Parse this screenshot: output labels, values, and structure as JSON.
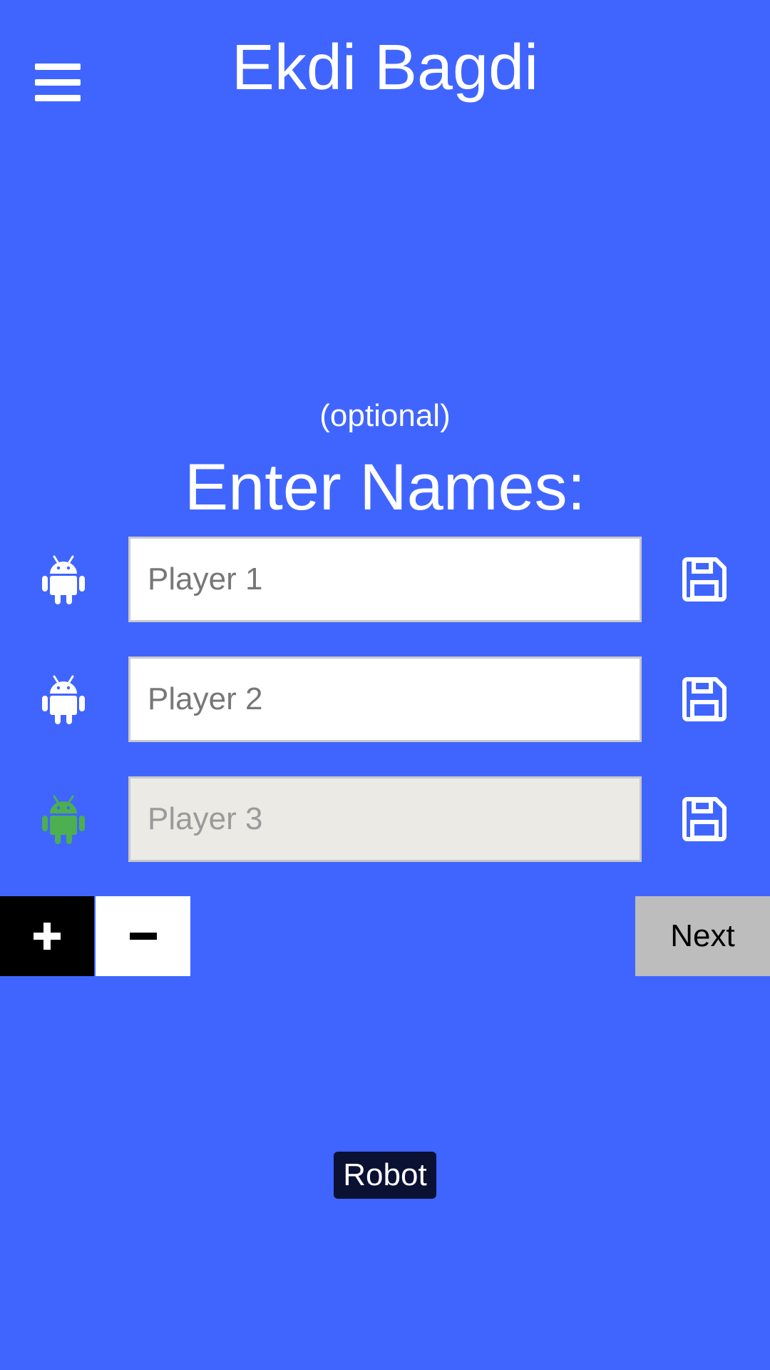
{
  "header": {
    "title": "Ekdi Bagdi",
    "menu_icon": "hamburger-menu-icon"
  },
  "form": {
    "optional_hint": "(optional)",
    "heading": "Enter Names:",
    "players": [
      {
        "placeholder": "Player 1",
        "value": "",
        "icon": "android-robot-icon",
        "icon_color": "#FFFFFF",
        "enabled": true,
        "save_icon": "floppy-disk-save-icon"
      },
      {
        "placeholder": "Player 2",
        "value": "",
        "icon": "android-robot-icon",
        "icon_color": "#FFFFFF",
        "enabled": true,
        "save_icon": "floppy-disk-save-icon"
      },
      {
        "placeholder": "Player 3",
        "value": "",
        "icon": "android-robot-icon",
        "icon_color": "#4CAF50",
        "enabled": false,
        "save_icon": "floppy-disk-save-icon"
      }
    ]
  },
  "controls": {
    "add_label": "+",
    "remove_label": "−",
    "next_label": "Next"
  },
  "footer": {
    "robot_label": "Robot"
  },
  "colors": {
    "background": "#4065FF",
    "robot_active": "#4CAF50",
    "robot_default": "#FFFFFF",
    "next_button": "#BDBDBD",
    "disabled_input": "#EBEAE4",
    "robot_label_bg": "#0A1133"
  }
}
